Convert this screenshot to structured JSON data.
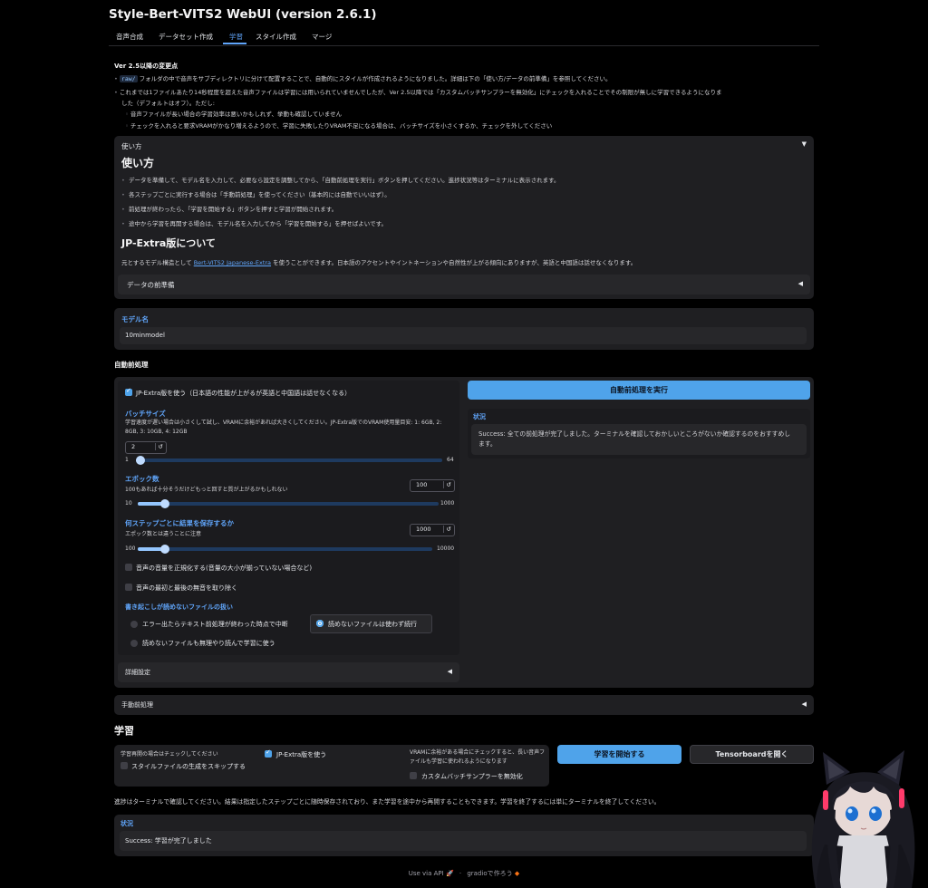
{
  "app": {
    "title": "Style-Bert-VITS2 WebUI (version 2.6.1)"
  },
  "tabs": [
    {
      "label": "音声合成"
    },
    {
      "label": "データセット作成"
    },
    {
      "label": "学習",
      "active": true
    },
    {
      "label": "スタイル作成"
    },
    {
      "label": "マージ"
    }
  ],
  "notice": {
    "heading": "Ver 2.5以降の変更点",
    "b1_code": "raw/",
    "b1_text": "フォルダの中で音声をサブディレクトリに分けて配置することで、自動的にスタイルが作成されるようになりました。詳細は下の「使い方/データの前準備」を参照してください。",
    "b2_line1": "これまでは1ファイルあたり14秒程度を超えた音声ファイルは学習には用いられていませんでしたが、Ver 2.5以降では「カスタムバッチサンプラーを無効化」にチェックを入れることでその制限が無しに学習できるようになりま",
    "b2_line2": "した（デフォルトはオフ）。ただし:",
    "sub1": "音声ファイルが長い場合の学習効率は悪いかもしれず、挙動も確認していません",
    "sub2": "チェックを入れると要求VRAMがかなり増えるようので、学習に失敗したりVRAM不足になる場合は、バッチサイズを小さくするか、チェックを外してください"
  },
  "usage": {
    "accordion_label": "使い方",
    "heading": "使い方",
    "items": [
      "データを準備して、モデル名を入力して、必要なら設定を調整してから、「自動前処理を実行」ボタンを押してください。進捗状況等はターミナルに表示されます。",
      "各ステップごとに実行する場合は「手動前処理」を使ってください（基本的には自動でいいはず）。",
      "前処理が終わったら、「学習を開始する」ボタンを押すと学習が開始されます。",
      "途中から学習を再開する場合は、モデル名を入力してから「学習を開始する」を押せばよいです。"
    ],
    "jp_heading": "JP-Extra版について",
    "jp_pre": "元とするモデル構造として",
    "jp_link": "Bert-VITS2 Japanese-Extra",
    "jp_post": "を使うことができます。日本語のアクセントやイントネーションや自然性が上がる傾向にありますが、英語と中国語は話せなくなります。",
    "data_prep_label": "データの前準備"
  },
  "model": {
    "label": "モデル名",
    "value": "10minmodel"
  },
  "auto_preprocess": {
    "section_label": "自動前処理",
    "jp_extra_label": "JP-Extra版を使う（日本語の性能が上がるが英語と中国語は話せなくなる）",
    "jp_extra_checked": true,
    "batch": {
      "label": "バッチサイズ",
      "info": "学習速度が遅い場合は小さくして試し、VRAMに余裕があれば大きくしてください。JP-Extra版でのVRAM使用量目安: 1: 6GB, 2: 8GB, 3: 10GB, 4: 12GB",
      "value": "2",
      "min": "1",
      "max": "64",
      "num": 2,
      "lo": 1,
      "hi": 64
    },
    "epochs": {
      "label": "エポック数",
      "info": "100もあれば十分そうだけどもっと回すと質が上がるかもしれない",
      "value": "100",
      "min": "10",
      "max": "1000",
      "num": 100,
      "lo": 10,
      "hi": 1000
    },
    "save_every": {
      "label": "何ステップごとに結果を保存するか",
      "info": "エポック数とは違うことに注意",
      "value": "1000",
      "min": "100",
      "max": "10000",
      "num": 1000,
      "lo": 100,
      "hi": 10000
    },
    "normalize_label": "音声の音量を正規化する(音量の大小が揃っていない場合など)",
    "trim_label": "音声の最初と最後の無音を取り除く",
    "unreadable": {
      "label": "書き起こしが読めないファイルの扱い",
      "opt1": "エラー出たらテキスト前処理が終わった時点で中断",
      "opt2": "読めないファイルは使わず続行",
      "opt3": "読めないファイルも無理やり読んで学習に使う",
      "selected": "読めないファイルは使わず続行"
    },
    "advanced_label": "詳細設定",
    "run_button": "自動前処理を実行",
    "status_label": "状況",
    "status_text": "Success: 全ての前処理が完了しました。ターミナルを確認しておかしいところがないか確認するのをおすすめします。"
  },
  "manual_preprocess": {
    "label": "手動前処理"
  },
  "training": {
    "heading": "学習",
    "resume_info": "学習再開の場合はチェックしてください",
    "skip_style_label": "スタイルファイルの生成をスキップする",
    "jp_extra_label": "JP-Extra版を使う",
    "vram_info": "VRAMに余裕がある場合にチェックすると、長い音声ファイルも学習に使われるようになります",
    "custom_batch_label": "カスタムバッチサンプラーを無効化",
    "start_button": "学習を開始する",
    "tensorboard_button": "Tensorboardを開く",
    "note": "進捗はターミナルで確認してください。結果は指定したステップごとに随時保存されており、また学習を途中から再開することもできます。学習を終了するには単にターミナルを終了してください。",
    "status_label": "状況",
    "status_text": "Success: 学習が完了しました"
  },
  "footer": {
    "api": "Use via API",
    "sep": "·",
    "gradio": "gradioで作ろう"
  },
  "colors": {
    "accent": "#4fa3ea",
    "panel": "#1f1f22",
    "label_blue": "#60a5fa"
  }
}
